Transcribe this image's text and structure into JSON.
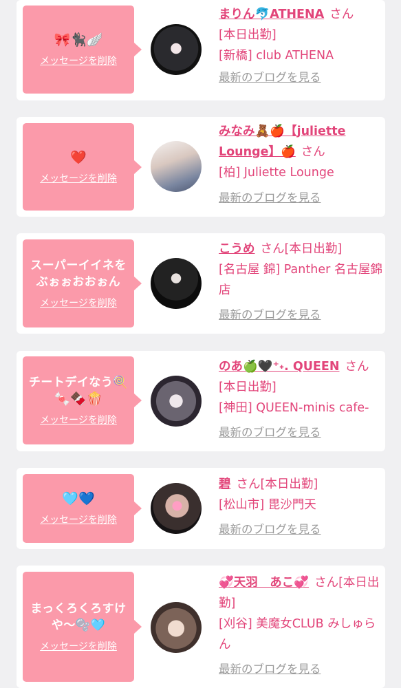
{
  "delete_label": "メッセージを削除",
  "san": "さん",
  "blog_label": "最新のブログを見る",
  "colors": {
    "accent": "#e2457a",
    "bubble": "#fb9aaa",
    "link_gray": "#9a9a9a",
    "background": "#f0f0f2"
  },
  "items": [
    {
      "message": "",
      "message_emoji": "🎀🐈‍⬛🪽",
      "name": "まりん🐬ATHENA",
      "status": "[本日出勤]",
      "location": "[新橋] club ATHENA",
      "avatar_icon": "avatar-photo-icon"
    },
    {
      "message": "",
      "message_emoji": "❤️",
      "name": "みなみ🧸🍎【juliette Lounge】🍎",
      "status": "",
      "location": "[柏] Juliette Lounge",
      "avatar_icon": "avatar-photo-icon"
    },
    {
      "message": "スーパーイイネをぶぉぉおおぉん",
      "message_emoji": "",
      "name": "こうめ",
      "status": "[本日出勤]",
      "location": "[名古屋 錦] Panther 名古屋錦店",
      "avatar_icon": "avatar-photo-icon"
    },
    {
      "message": "チートデイなう🍭",
      "message_emoji": "🍬🍫🍿",
      "name": "のあ🍏🖤⁺˖. QUEEN",
      "status": "[本日出勤]",
      "location": "[神田] QUEEN-minis cafe-",
      "avatar_icon": "avatar-photo-icon"
    },
    {
      "message": "",
      "message_emoji": "🩵💙",
      "name": "碧",
      "status": "[本日出勤]",
      "location": "[松山市] 毘沙門天",
      "avatar_icon": "avatar-photo-icon"
    },
    {
      "message": "まっくろくろすけや〜🫧🩵",
      "message_emoji": "",
      "name": "💞天羽　あこ💞",
      "status": "[本日出勤]",
      "location": "[刈谷] 美魔女CLUB みしゅらん",
      "avatar_icon": "avatar-photo-icon"
    }
  ]
}
